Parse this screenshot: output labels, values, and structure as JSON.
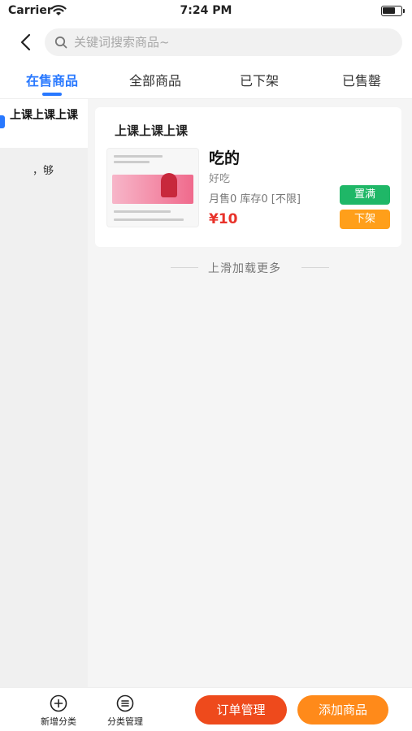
{
  "status_bar": {
    "carrier": "Carrier",
    "time": "7:24 PM"
  },
  "search": {
    "placeholder": "关键词搜索商品~"
  },
  "tabs": [
    {
      "label": "在售商品",
      "active": true
    },
    {
      "label": "全部商品",
      "active": false
    },
    {
      "label": "已下架",
      "active": false
    },
    {
      "label": "已售罄",
      "active": false
    }
  ],
  "sidebar": {
    "items": [
      {
        "label": "上课上课上课",
        "active": true
      },
      {
        "label": "，够",
        "active": false
      }
    ]
  },
  "product_card": {
    "category": "上课上课上课",
    "name": "吃的",
    "description": "好吃",
    "stats": "月售0 库存0 [不限]",
    "price": "¥10",
    "fill_stock_label": "置满",
    "take_down_label": "下架"
  },
  "load_more": "上滑加载更多",
  "bottom_bar": {
    "add_category_label": "新增分类",
    "manage_category_label": "分类管理",
    "orders_label": "订单管理",
    "add_product_label": "添加商品"
  },
  "colors": {
    "accent": "#2878ff",
    "price": "#e8322a",
    "fill_button": "#1fb767",
    "take_down_button": "#ff9f1a",
    "orders_button": "#ee4a1c",
    "add_product_button": "#ff8a1a"
  },
  "icons": {
    "wifi": "wifi-icon",
    "battery": "battery-icon",
    "back": "back-icon",
    "search": "search-icon",
    "add_category": "plus-circle-icon",
    "manage_category": "list-circle-icon"
  }
}
